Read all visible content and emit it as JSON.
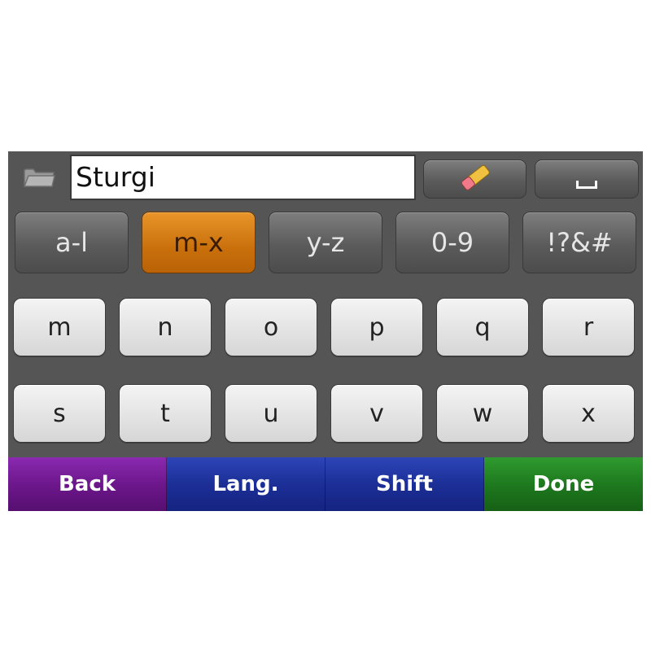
{
  "input": {
    "value": "Sturgi"
  },
  "toolbar": {
    "eraser_icon": "eraser-icon",
    "space_icon": "space-icon",
    "folder_icon": "folder-icon"
  },
  "groups": [
    "a-l",
    "m-x",
    "y-z",
    "0-9",
    "!?&#"
  ],
  "active_group": "m-x",
  "keys": {
    "row1": [
      "m",
      "n",
      "o",
      "p",
      "q",
      "r"
    ],
    "row2": [
      "s",
      "t",
      "u",
      "v",
      "w",
      "x"
    ]
  },
  "bottom": {
    "back": "Back",
    "lang": "Lang.",
    "shift": "Shift",
    "done": "Done"
  },
  "colors": {
    "active_group": "#d97f1a",
    "back": "#6d178c",
    "lang": "#1c2f97",
    "shift": "#1c2f97",
    "done": "#1e7a1e"
  }
}
